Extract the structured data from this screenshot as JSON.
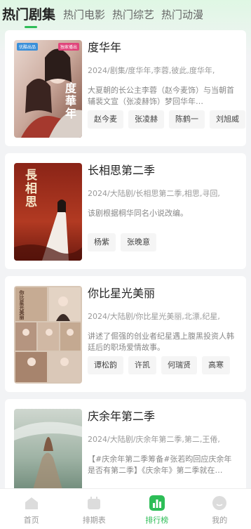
{
  "tabs": [
    {
      "label": "热门剧集",
      "active": true
    },
    {
      "label": "热门电影",
      "active": false
    },
    {
      "label": "热门综艺",
      "active": false
    },
    {
      "label": "热门动漫",
      "active": false
    }
  ],
  "cards": [
    {
      "title": "度华年",
      "meta": "2024/剧集/度华年,李蓉,彼此,度华年,",
      "desc": "大夏朝的长公主李蓉（赵今麦饰）与当朝首辅裴文宣（张凌赫饰）梦回华年…",
      "cast": [
        "赵今麦",
        "张凌赫",
        "陈鹤一",
        "刘旭威"
      ],
      "poster": {
        "text": "度華年",
        "badge_left": "优酷出品",
        "badge_right": "独家播出"
      }
    },
    {
      "title": "长相思第二季",
      "meta": "2024/大陆剧/长相思第二季,相思,寻回,",
      "desc": "该剧根据桐华同名小说改编。",
      "cast": [
        "杨紫",
        "张晚意"
      ],
      "poster": {
        "text": "長相思"
      }
    },
    {
      "title": "你比星光美丽",
      "meta": "2024/大陆剧/你比星光美丽,北漂,纪星,",
      "desc": "讲述了倔强的创业者纪星遇上腹黑投资人韩廷后的职场爱情故事。",
      "cast": [
        "谭松韵",
        "许凯",
        "何瑞贤",
        "高寒"
      ],
      "poster": {
        "text": "你比星光美丽"
      }
    },
    {
      "title": "庆余年第二季",
      "meta": "2024/大陆剧/庆余年第二季,第二,王倦,",
      "desc": "【#庆余年第二季筹备#张若昀回应庆余年是否有第二季】《庆余年》第二季就在…",
      "cast": [],
      "poster": {
        "text": ""
      }
    }
  ],
  "nav": [
    {
      "label": "首页",
      "icon": "home-icon",
      "active": false
    },
    {
      "label": "排期表",
      "icon": "calendar-icon",
      "active": false
    },
    {
      "label": "排行榜",
      "icon": "ranking-icon",
      "active": true
    },
    {
      "label": "我的",
      "icon": "profile-icon",
      "active": false
    }
  ],
  "colors": {
    "accent": "#2dbd57",
    "background": "#f2f3f5"
  }
}
